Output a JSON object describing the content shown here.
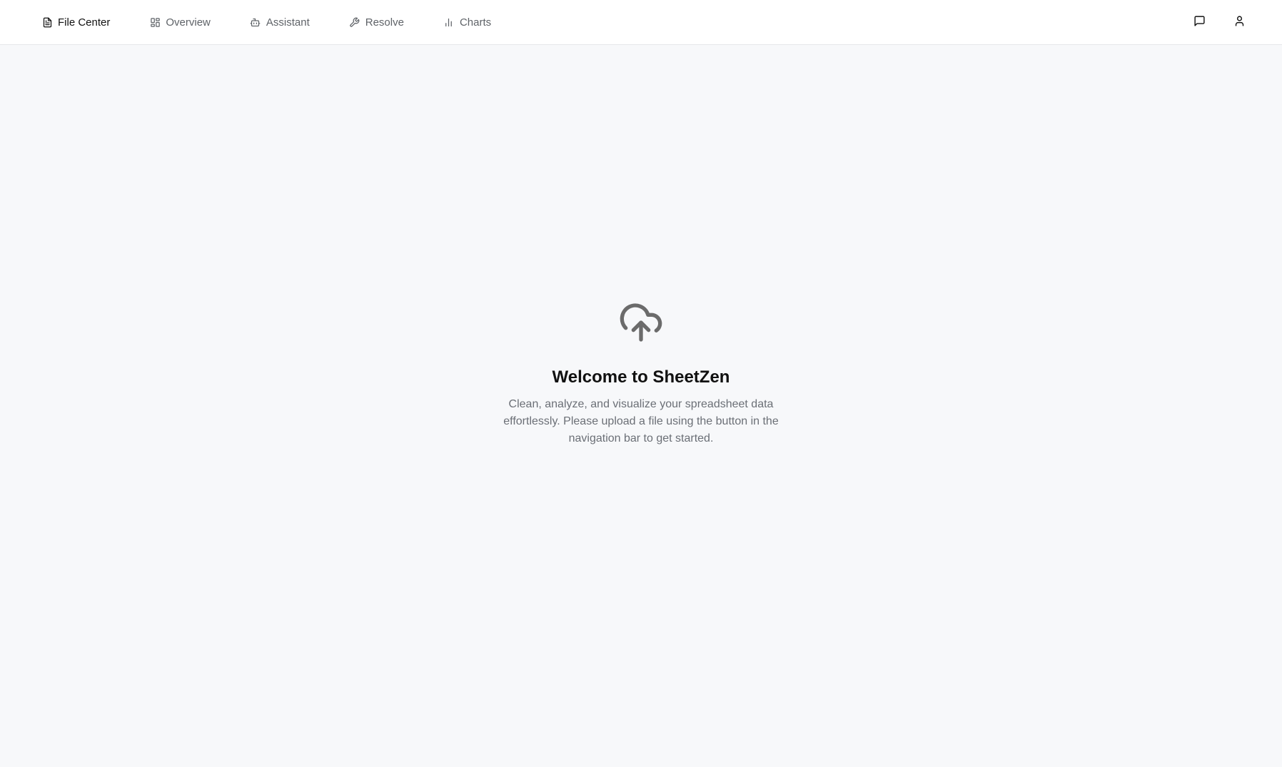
{
  "nav": {
    "items": [
      {
        "label": "File Center",
        "icon": "file-text-icon",
        "active": true
      },
      {
        "label": "Overview",
        "icon": "layout-grid-icon",
        "active": false
      },
      {
        "label": "Assistant",
        "icon": "bot-icon",
        "active": false
      },
      {
        "label": "Resolve",
        "icon": "wrench-icon",
        "active": false
      },
      {
        "label": "Charts",
        "icon": "bar-chart-icon",
        "active": false
      }
    ]
  },
  "actions": {
    "feedback_icon": "message-square-icon",
    "profile_icon": "user-icon"
  },
  "welcome": {
    "icon": "cloud-upload-icon",
    "title": "Welcome to SheetZen",
    "text": "Clean, analyze, and visualize your spreadsheet data effortlessly. Please upload a file using the button in the navigation bar to get started."
  },
  "colors": {
    "background": "#f7f8fa",
    "topbar": "#ffffff",
    "muted_text": "#6b6f76",
    "icon_gray": "#6b6b6b"
  }
}
